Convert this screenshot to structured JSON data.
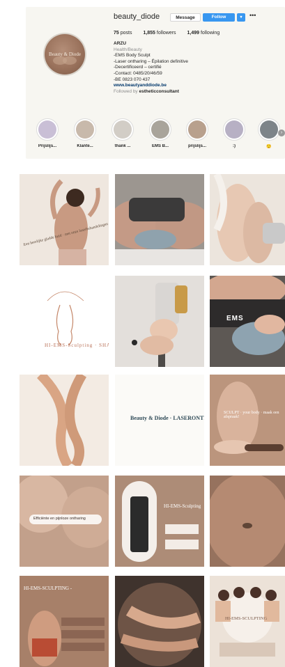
{
  "profile": {
    "username": "beauty_diode",
    "avatar_text": "Beauty & Diode",
    "message_label": "Message",
    "follow_label": "Follow",
    "dropdown_icon": "chevron-down-icon",
    "more_icon": "more-horizontal-icon",
    "posts_count": "75",
    "posts_label": "posts",
    "followers_count": "1,855",
    "followers_label": "followers",
    "following_count": "1,499",
    "following_label": "following",
    "bio_name": "ARZU",
    "bio_category": "Health/Beauty",
    "bio_lines": [
      "-EMS Body Sculpt",
      "-Laser ontharing – Épilation definitive",
      "-Decertificeerd – certifié",
      "-Contact: 0485/20/46/59",
      "-BE 0823 070 437"
    ],
    "website": "www.beautyanddiode.be",
    "followed_by_prefix": "Followed by",
    "followed_by_user": "estheticconsultant"
  },
  "highlights": [
    {
      "label": "Prijslijs...",
      "color": "#c9bfd6"
    },
    {
      "label": "Klante...",
      "color": "#c8b9ab"
    },
    {
      "label": "thank ...",
      "color": "#d2cdc6"
    },
    {
      "label": "EMS B...",
      "color": "#a9a49b"
    },
    {
      "label": "prijslijs...",
      "color": "#b8a08d"
    },
    {
      "label": ":)",
      "color": "#b7b0c4"
    },
    {
      "label": "😌",
      "color": "#7d8489"
    }
  ],
  "highlight_arrow_icon": "chevron-right-icon",
  "posts": [
    {
      "name": "post-back-treatment",
      "bg": "#efe7df",
      "text": "Een heerlijke gladde huid · met onze laserbehandelingen",
      "text_color": "#5a4636"
    },
    {
      "name": "post-ems-belt",
      "bg": "#8c8680",
      "text": "",
      "text_color": "#ffffff"
    },
    {
      "name": "post-legs-cream",
      "bg": "#e8ddd3",
      "text": "",
      "text_color": "#ffffff"
    },
    {
      "name": "post-shaping-logo",
      "bg": "#ffffff",
      "text": "HI-EMS-Sculpting · SHAPING",
      "text_color": "#b86f55"
    },
    {
      "name": "post-laser-handpiece",
      "bg": "#d8d3cf",
      "text": "",
      "text_color": "#ffffff"
    },
    {
      "name": "post-ems-device",
      "bg": "#6f6660",
      "text": "EMS",
      "text_color": "#ffffff"
    },
    {
      "name": "post-crossed-legs",
      "bg": "#efe3d7",
      "text": "",
      "text_color": "#ffffff"
    },
    {
      "name": "post-brand-logo",
      "bg": "#fbfaf7",
      "text": "Beauty & Diode · LASERONTHARING",
      "text_color": "#2f4a57"
    },
    {
      "name": "post-sculpt",
      "bg": "#b58f77",
      "text": "SCULPT · your body · maak een afspraak!",
      "text_color": "#ffffff"
    },
    {
      "name": "post-efficient-hair-removal",
      "bg": "#ad8873",
      "text": "Efficiënte en pijnloze ontharing",
      "text_color": "#3a2c25"
    },
    {
      "name": "post-hi-ems-machine",
      "bg": "#a98873",
      "text": "HI-EMS-Sculpting",
      "text_color": "#ffffff"
    },
    {
      "name": "post-belly",
      "bg": "#8c6d5c",
      "text": "",
      "text_color": "#ffffff"
    },
    {
      "name": "post-hi-ems-banner",
      "bg": "#a57e68",
      "text": "HI-EMS-SCULPTING -",
      "text_color": "#ffffff"
    },
    {
      "name": "post-legs-round",
      "bg": "#4b3d35",
      "text": "",
      "text_color": "#ffffff"
    },
    {
      "name": "post-hi-ems-group",
      "bg": "#e9ddd1",
      "text": "HI-EMS-SCULPTING",
      "text_color": "#7a5a4a"
    }
  ]
}
